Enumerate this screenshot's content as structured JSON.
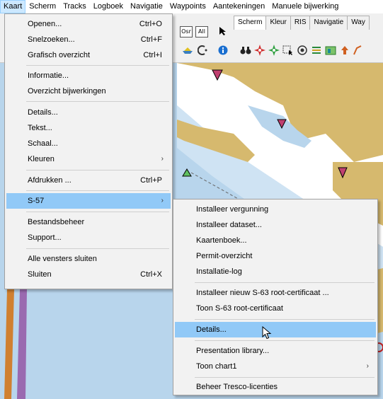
{
  "menubar": {
    "items": [
      "Kaart",
      "Scherm",
      "Tracks",
      "Logboek",
      "Navigatie",
      "Waypoints",
      "Aantekeningen",
      "Manuele bijwerking"
    ]
  },
  "toolbar": {
    "box_buttons": [
      "Osr",
      "All"
    ],
    "tabs": [
      "Scherm",
      "Kleur",
      "RIS",
      "Navigatie",
      "Way"
    ]
  },
  "kaart_menu": {
    "items": [
      {
        "label": "Openen...",
        "shortcut": "Ctrl+O"
      },
      {
        "label": "Snelzoeken...",
        "shortcut": "Ctrl+F"
      },
      {
        "label": "Grafisch overzicht",
        "shortcut": "Ctrl+I"
      },
      {
        "label": "Informatie...",
        "shortcut": ""
      },
      {
        "label": "Overzicht bijwerkingen",
        "shortcut": ""
      },
      {
        "label": "Details...",
        "shortcut": ""
      },
      {
        "label": "Tekst...",
        "shortcut": ""
      },
      {
        "label": "Schaal...",
        "shortcut": ""
      },
      {
        "label": "Kleuren",
        "shortcut": ""
      },
      {
        "label": "Afdrukken ...",
        "shortcut": "Ctrl+P"
      },
      {
        "label": "S-57",
        "shortcut": ""
      },
      {
        "label": "Bestandsbeheer",
        "shortcut": ""
      },
      {
        "label": "Support...",
        "shortcut": ""
      },
      {
        "label": "Alle vensters sluiten",
        "shortcut": ""
      },
      {
        "label": "Sluiten",
        "shortcut": "Ctrl+X"
      }
    ]
  },
  "s57_menu": {
    "items": [
      {
        "label": "Installeer vergunning"
      },
      {
        "label": "Installeer dataset..."
      },
      {
        "label": "Kaartenboek..."
      },
      {
        "label": "Permit-overzicht"
      },
      {
        "label": "Installatie-log"
      },
      {
        "label": "Installeer nieuw S-63 root-certificaat ..."
      },
      {
        "label": "Toon S-63 root-certificaat"
      },
      {
        "label": "Details..."
      },
      {
        "label": "Presentation library..."
      },
      {
        "label": "Toon chart1"
      },
      {
        "label": "Beheer Tresco-licenties"
      }
    ]
  },
  "icons": {
    "submenu_arrow": "chevron-right-icon",
    "cursor": "mouse-pointer-icon"
  },
  "colors": {
    "highlight": "#91c9f7",
    "map_water": "#b8d5ec",
    "map_land": "#d6b96e",
    "menubar_active": "#cce8ff"
  }
}
